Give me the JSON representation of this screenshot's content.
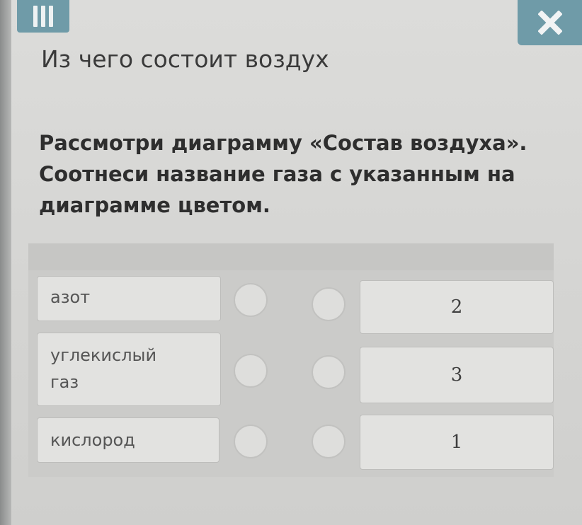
{
  "header": {
    "menu_icon": "menu-icon",
    "close_icon": "close-icon",
    "accent_color": "#6f9ba8"
  },
  "title": "Из чего состоит воздух",
  "question": "Рассмотри диаграмму «Состав воздуха». Соотнеси название газа с указанным на диаграмме цветом.",
  "left_items": [
    {
      "label": "азот"
    },
    {
      "label": "углекислый газ"
    },
    {
      "label": "кислород"
    }
  ],
  "right_items": [
    {
      "label": "2"
    },
    {
      "label": "3"
    },
    {
      "label": "1"
    }
  ]
}
